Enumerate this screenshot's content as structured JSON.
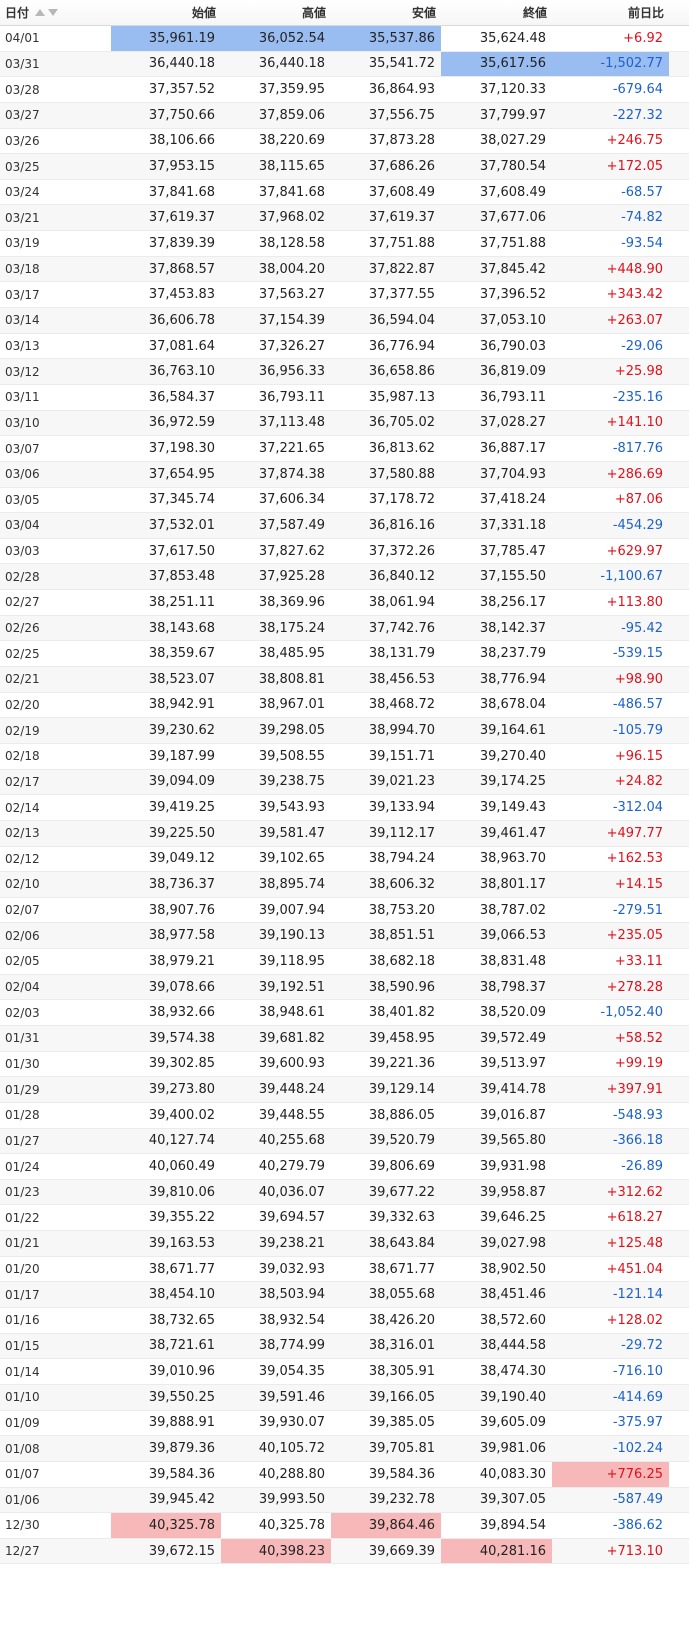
{
  "header": {
    "date": "日付",
    "open": "始値",
    "high": "高値",
    "low": "安値",
    "close": "終値",
    "change": "前日比",
    "sort_icons": [
      "sort-asc-icon",
      "sort-desc-icon"
    ]
  },
  "colors": {
    "positive": "#e0111b",
    "negative": "#1c62c9",
    "highlight_low": "#99bdf0",
    "highlight_high": "#f6b8b8"
  },
  "rows": [
    {
      "date": "04/01",
      "open": "35,961.19",
      "high": "36,052.54",
      "low": "35,537.86",
      "close": "35,624.48",
      "change": "+6.92",
      "hl": {
        "open": "blue",
        "high": "blue",
        "low": "blue"
      }
    },
    {
      "date": "03/31",
      "open": "36,440.18",
      "high": "36,440.18",
      "low": "35,541.72",
      "close": "35,617.56",
      "change": "-1,502.77",
      "hl": {
        "close": "blue",
        "change": "blue"
      }
    },
    {
      "date": "03/28",
      "open": "37,357.52",
      "high": "37,359.95",
      "low": "36,864.93",
      "close": "37,120.33",
      "change": "-679.64"
    },
    {
      "date": "03/27",
      "open": "37,750.66",
      "high": "37,859.06",
      "low": "37,556.75",
      "close": "37,799.97",
      "change": "-227.32"
    },
    {
      "date": "03/26",
      "open": "38,106.66",
      "high": "38,220.69",
      "low": "37,873.28",
      "close": "38,027.29",
      "change": "+246.75"
    },
    {
      "date": "03/25",
      "open": "37,953.15",
      "high": "38,115.65",
      "low": "37,686.26",
      "close": "37,780.54",
      "change": "+172.05"
    },
    {
      "date": "03/24",
      "open": "37,841.68",
      "high": "37,841.68",
      "low": "37,608.49",
      "close": "37,608.49",
      "change": "-68.57"
    },
    {
      "date": "03/21",
      "open": "37,619.37",
      "high": "37,968.02",
      "low": "37,619.37",
      "close": "37,677.06",
      "change": "-74.82"
    },
    {
      "date": "03/19",
      "open": "37,839.39",
      "high": "38,128.58",
      "low": "37,751.88",
      "close": "37,751.88",
      "change": "-93.54"
    },
    {
      "date": "03/18",
      "open": "37,868.57",
      "high": "38,004.20",
      "low": "37,822.87",
      "close": "37,845.42",
      "change": "+448.90"
    },
    {
      "date": "03/17",
      "open": "37,453.83",
      "high": "37,563.27",
      "low": "37,377.55",
      "close": "37,396.52",
      "change": "+343.42"
    },
    {
      "date": "03/14",
      "open": "36,606.78",
      "high": "37,154.39",
      "low": "36,594.04",
      "close": "37,053.10",
      "change": "+263.07"
    },
    {
      "date": "03/13",
      "open": "37,081.64",
      "high": "37,326.27",
      "low": "36,776.94",
      "close": "36,790.03",
      "change": "-29.06"
    },
    {
      "date": "03/12",
      "open": "36,763.10",
      "high": "36,956.33",
      "low": "36,658.86",
      "close": "36,819.09",
      "change": "+25.98"
    },
    {
      "date": "03/11",
      "open": "36,584.37",
      "high": "36,793.11",
      "low": "35,987.13",
      "close": "36,793.11",
      "change": "-235.16"
    },
    {
      "date": "03/10",
      "open": "36,972.59",
      "high": "37,113.48",
      "low": "36,705.02",
      "close": "37,028.27",
      "change": "+141.10"
    },
    {
      "date": "03/07",
      "open": "37,198.30",
      "high": "37,221.65",
      "low": "36,813.62",
      "close": "36,887.17",
      "change": "-817.76"
    },
    {
      "date": "03/06",
      "open": "37,654.95",
      "high": "37,874.38",
      "low": "37,580.88",
      "close": "37,704.93",
      "change": "+286.69"
    },
    {
      "date": "03/05",
      "open": "37,345.74",
      "high": "37,606.34",
      "low": "37,178.72",
      "close": "37,418.24",
      "change": "+87.06"
    },
    {
      "date": "03/04",
      "open": "37,532.01",
      "high": "37,587.49",
      "low": "36,816.16",
      "close": "37,331.18",
      "change": "-454.29"
    },
    {
      "date": "03/03",
      "open": "37,617.50",
      "high": "37,827.62",
      "low": "37,372.26",
      "close": "37,785.47",
      "change": "+629.97"
    },
    {
      "date": "02/28",
      "open": "37,853.48",
      "high": "37,925.28",
      "low": "36,840.12",
      "close": "37,155.50",
      "change": "-1,100.67"
    },
    {
      "date": "02/27",
      "open": "38,251.11",
      "high": "38,369.96",
      "low": "38,061.94",
      "close": "38,256.17",
      "change": "+113.80"
    },
    {
      "date": "02/26",
      "open": "38,143.68",
      "high": "38,175.24",
      "low": "37,742.76",
      "close": "38,142.37",
      "change": "-95.42"
    },
    {
      "date": "02/25",
      "open": "38,359.67",
      "high": "38,485.95",
      "low": "38,131.79",
      "close": "38,237.79",
      "change": "-539.15"
    },
    {
      "date": "02/21",
      "open": "38,523.07",
      "high": "38,808.81",
      "low": "38,456.53",
      "close": "38,776.94",
      "change": "+98.90"
    },
    {
      "date": "02/20",
      "open": "38,942.91",
      "high": "38,967.01",
      "low": "38,468.72",
      "close": "38,678.04",
      "change": "-486.57"
    },
    {
      "date": "02/19",
      "open": "39,230.62",
      "high": "39,298.05",
      "low": "38,994.70",
      "close": "39,164.61",
      "change": "-105.79"
    },
    {
      "date": "02/18",
      "open": "39,187.99",
      "high": "39,508.55",
      "low": "39,151.71",
      "close": "39,270.40",
      "change": "+96.15"
    },
    {
      "date": "02/17",
      "open": "39,094.09",
      "high": "39,238.75",
      "low": "39,021.23",
      "close": "39,174.25",
      "change": "+24.82"
    },
    {
      "date": "02/14",
      "open": "39,419.25",
      "high": "39,543.93",
      "low": "39,133.94",
      "close": "39,149.43",
      "change": "-312.04"
    },
    {
      "date": "02/13",
      "open": "39,225.50",
      "high": "39,581.47",
      "low": "39,112.17",
      "close": "39,461.47",
      "change": "+497.77"
    },
    {
      "date": "02/12",
      "open": "39,049.12",
      "high": "39,102.65",
      "low": "38,794.24",
      "close": "38,963.70",
      "change": "+162.53"
    },
    {
      "date": "02/10",
      "open": "38,736.37",
      "high": "38,895.74",
      "low": "38,606.32",
      "close": "38,801.17",
      "change": "+14.15"
    },
    {
      "date": "02/07",
      "open": "38,907.76",
      "high": "39,007.94",
      "low": "38,753.20",
      "close": "38,787.02",
      "change": "-279.51"
    },
    {
      "date": "02/06",
      "open": "38,977.58",
      "high": "39,190.13",
      "low": "38,851.51",
      "close": "39,066.53",
      "change": "+235.05"
    },
    {
      "date": "02/05",
      "open": "38,979.21",
      "high": "39,118.95",
      "low": "38,682.18",
      "close": "38,831.48",
      "change": "+33.11"
    },
    {
      "date": "02/04",
      "open": "39,078.66",
      "high": "39,192.51",
      "low": "38,590.96",
      "close": "38,798.37",
      "change": "+278.28"
    },
    {
      "date": "02/03",
      "open": "38,932.66",
      "high": "38,948.61",
      "low": "38,401.82",
      "close": "38,520.09",
      "change": "-1,052.40"
    },
    {
      "date": "01/31",
      "open": "39,574.38",
      "high": "39,681.82",
      "low": "39,458.95",
      "close": "39,572.49",
      "change": "+58.52"
    },
    {
      "date": "01/30",
      "open": "39,302.85",
      "high": "39,600.93",
      "low": "39,221.36",
      "close": "39,513.97",
      "change": "+99.19"
    },
    {
      "date": "01/29",
      "open": "39,273.80",
      "high": "39,448.24",
      "low": "39,129.14",
      "close": "39,414.78",
      "change": "+397.91"
    },
    {
      "date": "01/28",
      "open": "39,400.02",
      "high": "39,448.55",
      "low": "38,886.05",
      "close": "39,016.87",
      "change": "-548.93"
    },
    {
      "date": "01/27",
      "open": "40,127.74",
      "high": "40,255.68",
      "low": "39,520.79",
      "close": "39,565.80",
      "change": "-366.18"
    },
    {
      "date": "01/24",
      "open": "40,060.49",
      "high": "40,279.79",
      "low": "39,806.69",
      "close": "39,931.98",
      "change": "-26.89"
    },
    {
      "date": "01/23",
      "open": "39,810.06",
      "high": "40,036.07",
      "low": "39,677.22",
      "close": "39,958.87",
      "change": "+312.62"
    },
    {
      "date": "01/22",
      "open": "39,355.22",
      "high": "39,694.57",
      "low": "39,332.63",
      "close": "39,646.25",
      "change": "+618.27"
    },
    {
      "date": "01/21",
      "open": "39,163.53",
      "high": "39,238.21",
      "low": "38,643.84",
      "close": "39,027.98",
      "change": "+125.48"
    },
    {
      "date": "01/20",
      "open": "38,671.77",
      "high": "39,032.93",
      "low": "38,671.77",
      "close": "38,902.50",
      "change": "+451.04"
    },
    {
      "date": "01/17",
      "open": "38,454.10",
      "high": "38,503.94",
      "low": "38,055.68",
      "close": "38,451.46",
      "change": "-121.14"
    },
    {
      "date": "01/16",
      "open": "38,732.65",
      "high": "38,932.54",
      "low": "38,426.20",
      "close": "38,572.60",
      "change": "+128.02"
    },
    {
      "date": "01/15",
      "open": "38,721.61",
      "high": "38,774.99",
      "low": "38,316.01",
      "close": "38,444.58",
      "change": "-29.72"
    },
    {
      "date": "01/14",
      "open": "39,010.96",
      "high": "39,054.35",
      "low": "38,305.91",
      "close": "38,474.30",
      "change": "-716.10"
    },
    {
      "date": "01/10",
      "open": "39,550.25",
      "high": "39,591.46",
      "low": "39,166.05",
      "close": "39,190.40",
      "change": "-414.69"
    },
    {
      "date": "01/09",
      "open": "39,888.91",
      "high": "39,930.07",
      "low": "39,385.05",
      "close": "39,605.09",
      "change": "-375.97"
    },
    {
      "date": "01/08",
      "open": "39,879.36",
      "high": "40,105.72",
      "low": "39,705.81",
      "close": "39,981.06",
      "change": "-102.24"
    },
    {
      "date": "01/07",
      "open": "39,584.36",
      "high": "40,288.80",
      "low": "39,584.36",
      "close": "40,083.30",
      "change": "+776.25",
      "hl": {
        "change": "red"
      }
    },
    {
      "date": "01/06",
      "open": "39,945.42",
      "high": "39,993.50",
      "low": "39,232.78",
      "close": "39,307.05",
      "change": "-587.49"
    },
    {
      "date": "12/30",
      "open": "40,325.78",
      "high": "40,325.78",
      "low": "39,864.46",
      "close": "39,894.54",
      "change": "-386.62",
      "hl": {
        "open": "red",
        "low": "red"
      }
    },
    {
      "date": "12/27",
      "open": "39,672.15",
      "high": "40,398.23",
      "low": "39,669.39",
      "close": "40,281.16",
      "change": "+713.10",
      "hl": {
        "high": "red",
        "close": "red"
      }
    }
  ]
}
